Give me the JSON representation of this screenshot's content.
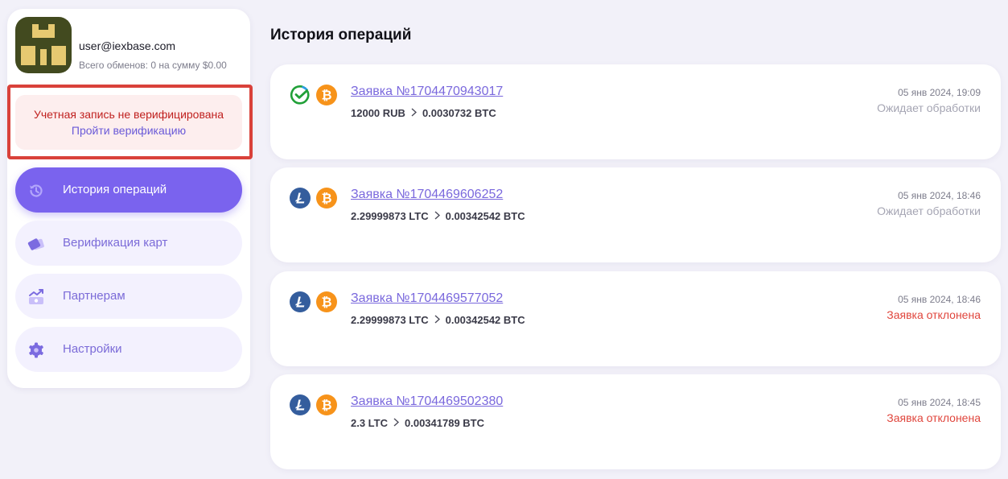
{
  "profile": {
    "email": "user@iexbase.com",
    "stats": "Всего обменов: 0 на сумму $0.00"
  },
  "verification": {
    "message": "Учетная запись не верифицирована",
    "link_label": "Пройти верификацию"
  },
  "nav": {
    "items": [
      {
        "label": "История операций",
        "icon": "history-icon",
        "active": true
      },
      {
        "label": "Верификация карт",
        "icon": "cards-icon",
        "active": false
      },
      {
        "label": "Партнерам",
        "icon": "partners-icon",
        "active": false
      },
      {
        "label": "Настройки",
        "icon": "gear-icon",
        "active": false
      }
    ]
  },
  "main": {
    "title": "История операций",
    "operations": [
      {
        "title": "Заявка №1704470943017",
        "from_amount": "12000 RUB",
        "to_amount": "0.0030732 BTC",
        "date": "05 янв 2024, 19:09",
        "status": "Ожидает обработки",
        "status_type": "pending",
        "from_icon": "sberbank-icon",
        "to_icon": "bitcoin-icon"
      },
      {
        "title": "Заявка №1704469606252",
        "from_amount": "2.29999873 LTC",
        "to_amount": "0.00342542 BTC",
        "date": "05 янв 2024, 18:46",
        "status": "Ожидает обработки",
        "status_type": "pending",
        "from_icon": "litecoin-icon",
        "to_icon": "bitcoin-icon"
      },
      {
        "title": "Заявка №1704469577052",
        "from_amount": "2.29999873 LTC",
        "to_amount": "0.00342542 BTC",
        "date": "05 янв 2024, 18:46",
        "status": "Заявка отклонена",
        "status_type": "rejected",
        "from_icon": "litecoin-icon",
        "to_icon": "bitcoin-icon"
      },
      {
        "title": "Заявка №1704469502380",
        "from_amount": "2.3 LTC",
        "to_amount": "0.00341789 BTC",
        "date": "05 янв 2024, 18:45",
        "status": "Заявка отклонена",
        "status_type": "rejected",
        "from_icon": "litecoin-icon",
        "to_icon": "bitcoin-icon"
      }
    ]
  },
  "colors": {
    "accent": "#7a63ee",
    "pending": "#a5a5b3",
    "rejected": "#e0453c",
    "alert_border": "#d9413a"
  }
}
